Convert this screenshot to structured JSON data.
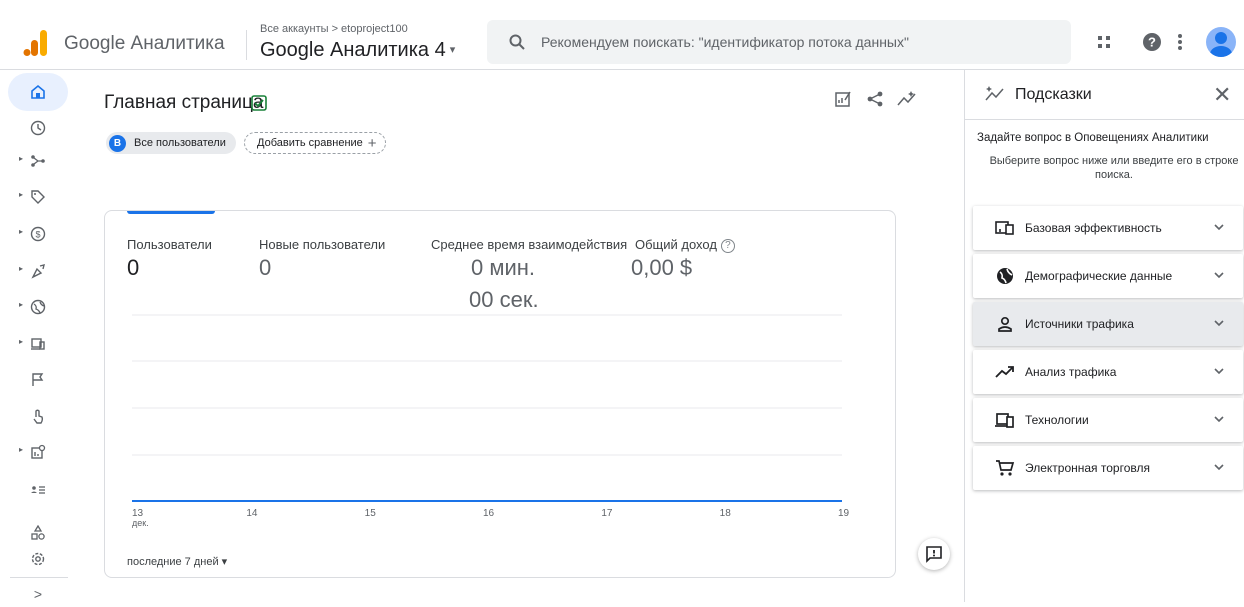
{
  "header": {
    "brand": "Google Аналитика",
    "account_crumb": "Все аккаунты > etoproject100",
    "property_name": "Google Аналитика 4",
    "property_caret": "▾",
    "search_placeholder": "Рекомендуем поискать: \"идентификатор потока данных\"",
    "icons": [
      "apps-icon",
      "help-icon",
      "more-vert-icon",
      "avatar"
    ]
  },
  "leftnav": {
    "items": [
      "home-icon",
      "realtime-icon",
      "lifecycle-icon",
      "tag-icon",
      "monetization-icon",
      "engagement-icon",
      "globe-icon",
      "tech-icon",
      "flag-icon",
      "gesture-icon",
      "explore-icon",
      "audience-icon",
      "configure-icon",
      "settings-icon"
    ],
    "expand_label": ">"
  },
  "main": {
    "title": "Главная страница",
    "chip_segment_letter": "B",
    "chip_segment": "Все пользователи",
    "chip_add": "Добавить сравнение",
    "chip_add_plus": "+",
    "metrics": [
      {
        "label": "Пользователи",
        "value": "0"
      },
      {
        "label": "Новые пользователи",
        "value": "0"
      },
      {
        "label": "Среднее время взаимодействия",
        "value_line1": "0 мин.",
        "value_line2": "00 сек."
      },
      {
        "label": "Общий доход",
        "value": "0,00 $"
      }
    ],
    "date_range": "последние 7 дней ▾"
  },
  "chart_data": {
    "type": "line",
    "title": "",
    "categories": [
      "13",
      "14",
      "15",
      "16",
      "17",
      "18",
      "19"
    ],
    "x_sublabel_first": "дек.",
    "series": [
      {
        "values": [
          0,
          0,
          0,
          0,
          0,
          0,
          0
        ]
      }
    ],
    "grid": true,
    "line_color": "#1a73e8"
  },
  "right_panel": {
    "title": "Подсказки",
    "close_label": "✕",
    "question": "Задайте вопрос в Оповещениях Аналитики",
    "hint": "Выберите вопрос ниже или введите его в строке поиска.",
    "suggestions": [
      {
        "label": "Базовая эффективность",
        "icon": "dashboard-icon"
      },
      {
        "label": "Демографические данные",
        "icon": "globe-icon"
      },
      {
        "label": "Источники трафика",
        "icon": "person-icon",
        "active": true
      },
      {
        "label": "Анализ трафика",
        "icon": "trending-icon"
      },
      {
        "label": "Технологии",
        "icon": "devices-icon"
      },
      {
        "label": "Электронная торговля",
        "icon": "cart-icon"
      }
    ]
  },
  "colors": {
    "accent": "#1a73e8",
    "logo_orange": "#f9ab00",
    "logo_dark": "#e37400"
  }
}
